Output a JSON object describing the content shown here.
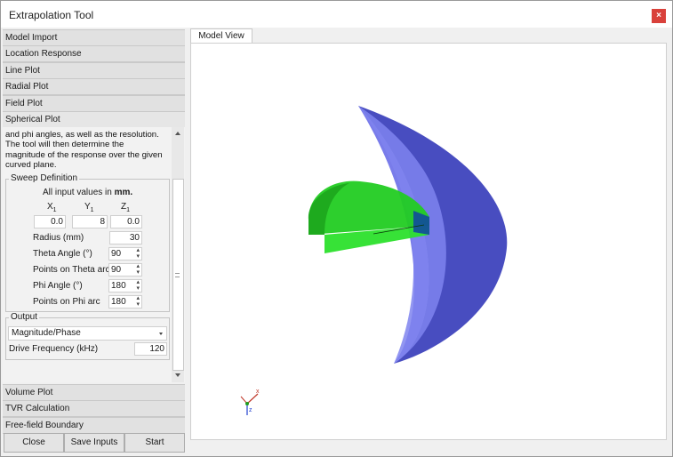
{
  "window": {
    "title": "Extrapolation Tool",
    "close_label": "×"
  },
  "accordion_top": [
    "Model Import",
    "Location Response",
    "Line Plot",
    "Radial Plot",
    "Field Plot",
    "Spherical Plot"
  ],
  "accordion_bottom": [
    "Volume Plot",
    "TVR Calculation",
    "Free-field Boundary"
  ],
  "description_lines": [
    "and phi angles, as well as the resolution.",
    "The tool will then determine the",
    "magnitude of the response over the given",
    "curved plane."
  ],
  "sweep": {
    "legend": "Sweep Definition",
    "note_prefix": "All input values in ",
    "note_unit": "mm.",
    "x_label": "X",
    "y_label": "Y",
    "z_label": "Z",
    "subscript": "1",
    "x_value": "0.0",
    "y_value": "8",
    "z_value": "0.0",
    "radius_label": "Radius (mm)",
    "radius_value": "30",
    "theta_angle_label": "Theta Angle (°)",
    "theta_angle_value": "90",
    "theta_points_label": "Points on Theta arc",
    "theta_points_value": "90",
    "phi_angle_label": "Phi Angle (°)",
    "phi_angle_value": "180",
    "phi_points_label": "Points on Phi arc",
    "phi_points_value": "180"
  },
  "output": {
    "legend": "Output",
    "mode_value": "Magnitude/Phase",
    "drive_freq_label": "Drive Frequency (kHz)",
    "drive_freq_value": "120"
  },
  "buttons": {
    "close": "Close",
    "save": "Save Inputs",
    "start": "Start"
  },
  "tab": {
    "model_view": "Model View"
  },
  "axes": {
    "x": "x",
    "y": "y",
    "z": "z"
  },
  "colors": {
    "close_red": "#d9413b",
    "hemisphere_blue": "#6a6ee8",
    "half_disk_green": "#22cc22"
  },
  "icons": {
    "scroll_up": "scroll-up-icon",
    "scroll_down": "scroll-down-icon",
    "dropdown": "chevron-down-icon",
    "close": "close-icon"
  }
}
